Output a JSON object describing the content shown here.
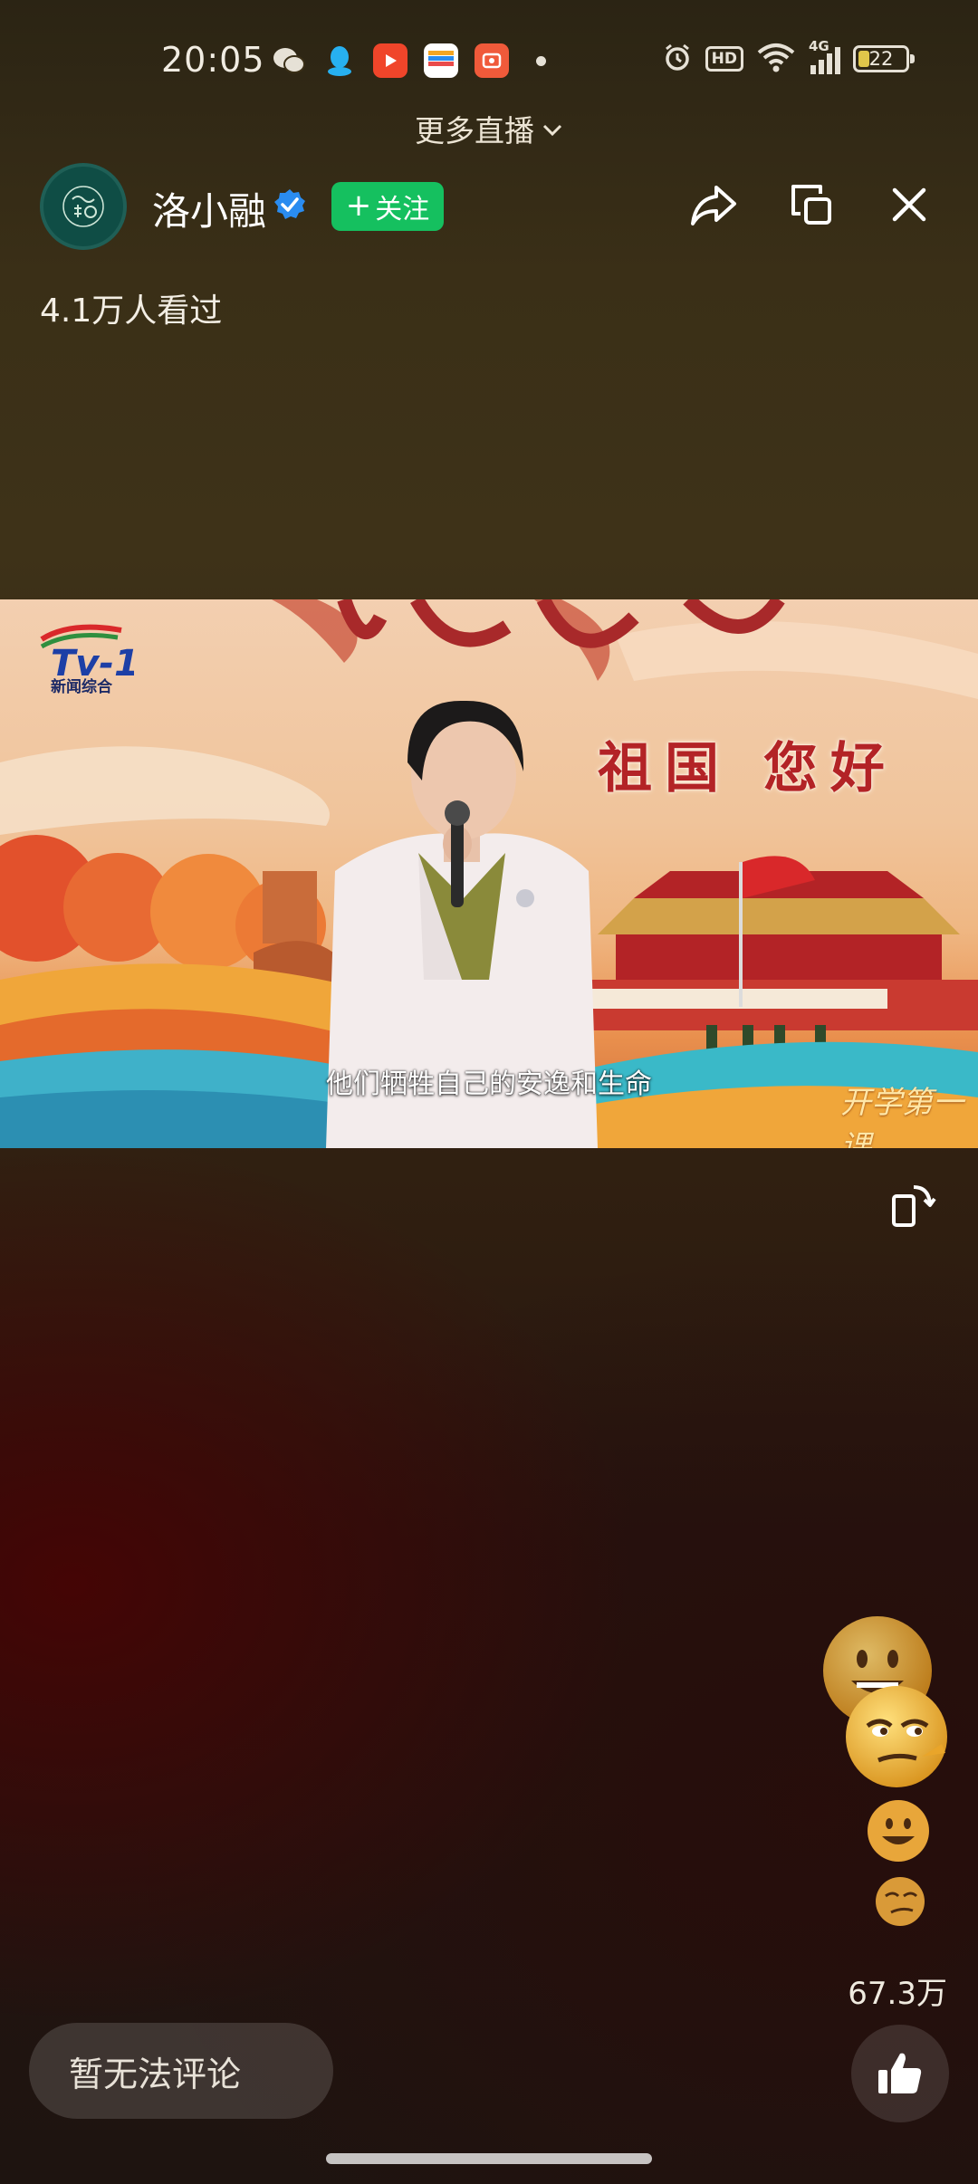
{
  "status_bar": {
    "time": "20:05",
    "apps": [
      "wechat-icon",
      "qq-icon",
      "video-app-icon",
      "wallet-app-icon",
      "camera-app-icon"
    ],
    "indicators": [
      "alarm-icon",
      "hd-icon",
      "wifi-icon",
      "signal-4g-icon"
    ],
    "hd_label": "HD",
    "network_label": "4G",
    "battery_level": "22"
  },
  "top": {
    "more_live_label": "更多直播"
  },
  "header": {
    "channel_name": "洛小融",
    "follow_label": "关注",
    "viewers_text": "4.1万人看过"
  },
  "video": {
    "channel_logo_text": "新闻综合",
    "slogan": "祖国 您好",
    "subtitle": "他们牺牲自己的安逸和生命",
    "watermark": "开学第一课"
  },
  "reactions": {
    "likes_count": "67.3万",
    "emojis": [
      "grinning-emoji",
      "smirk-emoji",
      "grinning-emoji",
      "smirk-emoji"
    ]
  },
  "footer": {
    "comment_placeholder": "暂无法评论"
  },
  "colors": {
    "follow_green": "#15c05f",
    "verified_blue": "#2a8cf0",
    "slogan_red": "#b32326"
  }
}
